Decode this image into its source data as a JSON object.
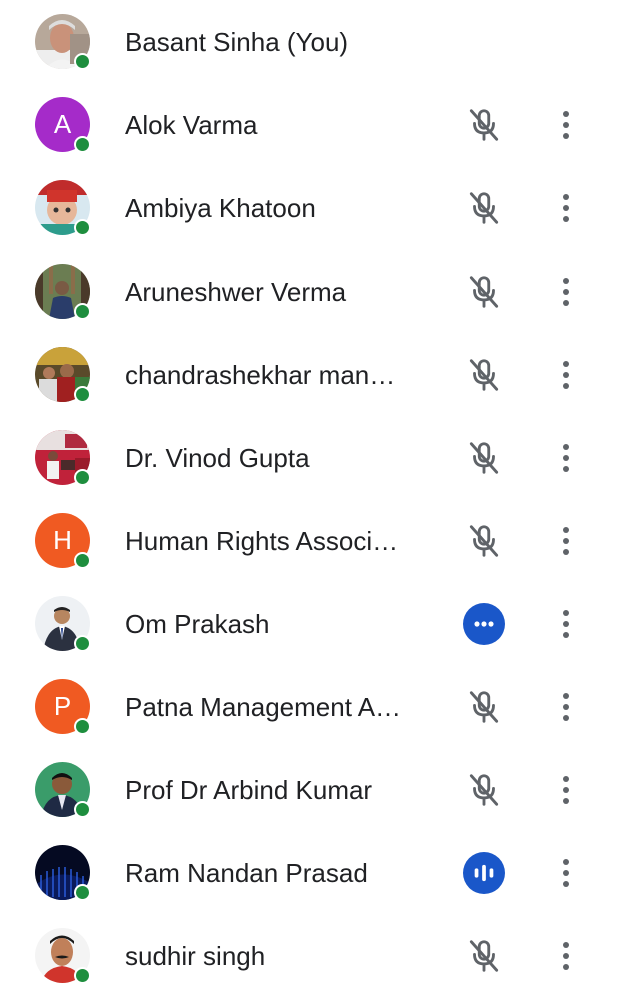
{
  "participants": [
    {
      "name": "Basant Sinha (You)",
      "avatar": "photo-elderly-man",
      "status": "none"
    },
    {
      "name": "Alok Varma",
      "avatar": "initial",
      "initial": "A",
      "avatar_color": "#a52bc9",
      "status": "muted"
    },
    {
      "name": "Ambiya Khatoon",
      "avatar": "photo-child",
      "status": "muted"
    },
    {
      "name": "Aruneshwer Verma",
      "avatar": "photo-man-outdoor",
      "status": "muted"
    },
    {
      "name": "chandrashekhar man…",
      "avatar": "photo-group",
      "status": "muted"
    },
    {
      "name": "Dr. Vinod Gupta",
      "avatar": "photo-stage",
      "status": "muted"
    },
    {
      "name": "Human Rights Associ…",
      "avatar": "initial",
      "initial": "H",
      "avatar_color": "#f05a22",
      "status": "muted"
    },
    {
      "name": "Om Prakash",
      "avatar": "photo-man-suit",
      "status": "more-badge"
    },
    {
      "name": "Patna Management A…",
      "avatar": "initial",
      "initial": "P",
      "avatar_color": "#f05a22",
      "status": "muted"
    },
    {
      "name": "Prof Dr Arbind Kumar",
      "avatar": "photo-man-green",
      "status": "muted"
    },
    {
      "name": "Ram Nandan Prasad",
      "avatar": "photo-dark-blue",
      "status": "speaking"
    },
    {
      "name": "sudhir singh",
      "avatar": "photo-man-mustache",
      "status": "muted"
    }
  ],
  "colors": {
    "presence": "#1e8e3e",
    "badge": "#1a57c9",
    "icon_gray": "#5f6368",
    "text": "#202124"
  }
}
